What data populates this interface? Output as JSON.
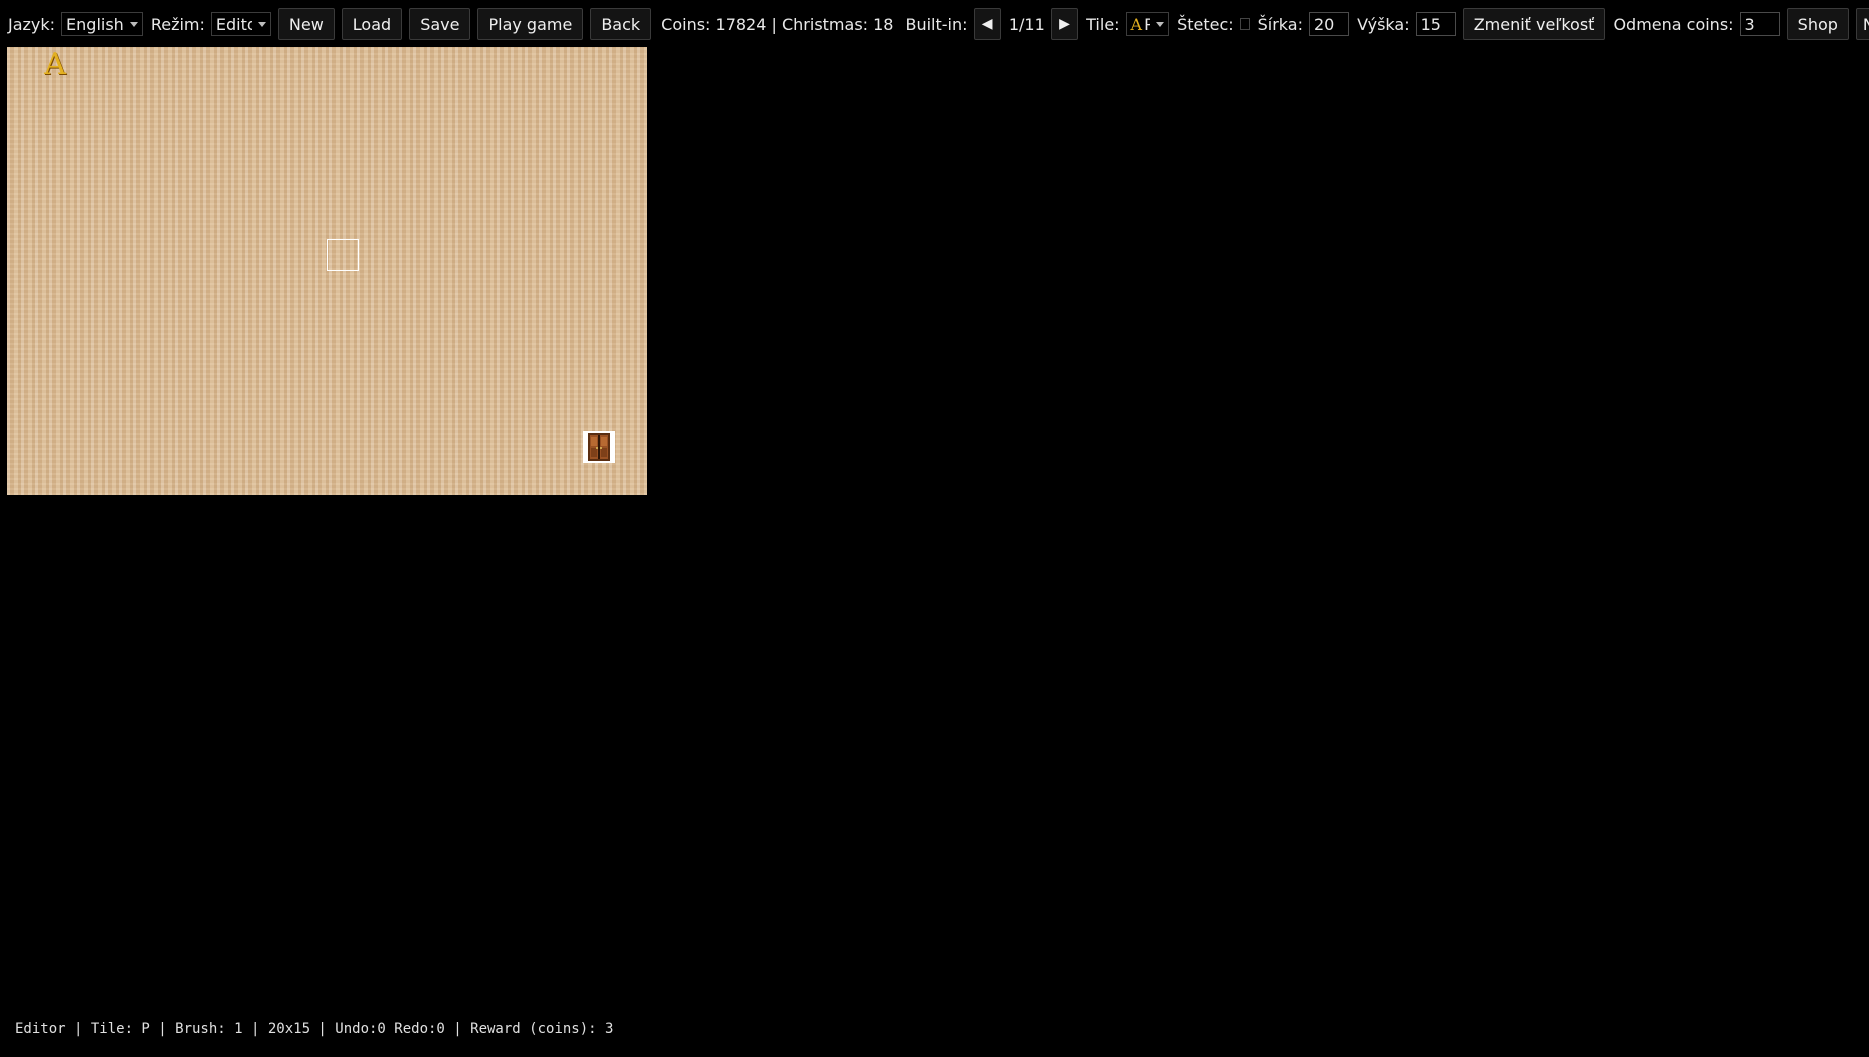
{
  "toolbar": {
    "language_label": "Jazyk:",
    "language_value": "English",
    "mode_label": "Režim:",
    "mode_value": "Edito",
    "new_label": "New",
    "load_label": "Load",
    "save_label": "Save",
    "play_label": "Play game",
    "back_label": "Back",
    "stats": "Coins: 17824 | Christmas: 18",
    "builtin_label": "Built-in:",
    "prev_symbol": "◀",
    "level_counter": "1/11",
    "next_symbol": "▶",
    "tile_label": "Tile:",
    "tile_glyph": "A",
    "tile_value": "P",
    "brush_label": "Štetec:",
    "width_label": "Šírka:",
    "width_value": "20",
    "height_label": "Výška:",
    "height_value": "15",
    "resize_label": "Zmeniť veľkosť",
    "reward_label": "Odmena coins:",
    "reward_value": "3",
    "shop_label": "Shop",
    "cut_label": "N"
  },
  "board": {
    "start_glyph": "A",
    "start_color": "#e3b020",
    "floor_color": "#dbbb93",
    "door_color": "#8a4a1e"
  },
  "status": {
    "text": "Editor | Tile: P | Brush: 1 | 20x15 | Undo:0 Redo:0 | Reward (coins): 3"
  }
}
